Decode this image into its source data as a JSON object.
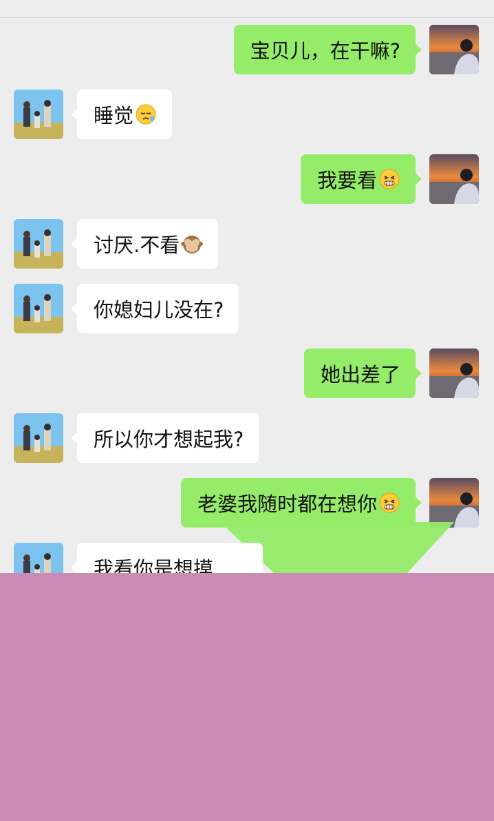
{
  "messages": [
    {
      "side": "self",
      "text": "宝贝儿，在干嘛?",
      "emoji": ""
    },
    {
      "side": "other",
      "text": "睡觉",
      "emoji": "sleepy-face"
    },
    {
      "side": "self",
      "text": "我要看",
      "emoji": "grinning-face"
    },
    {
      "side": "other",
      "text": "讨厌.不看",
      "emoji": "see-no-evil-monkey"
    },
    {
      "side": "other",
      "text": "你媳妇儿没在?",
      "emoji": ""
    },
    {
      "side": "self",
      "text": "她出差了",
      "emoji": ""
    },
    {
      "side": "other",
      "text": "所以你才想起我?",
      "emoji": ""
    },
    {
      "side": "self",
      "text": "老婆我随时都在想你",
      "emoji": "grinning-face"
    },
    {
      "side": "other",
      "text": "我看你是想摸",
      "emoji": ""
    }
  ],
  "colors": {
    "background": "#ededed",
    "self_bubble": "#95ec69",
    "other_bubble": "#ffffff",
    "overlay": "#ca8cb4"
  }
}
